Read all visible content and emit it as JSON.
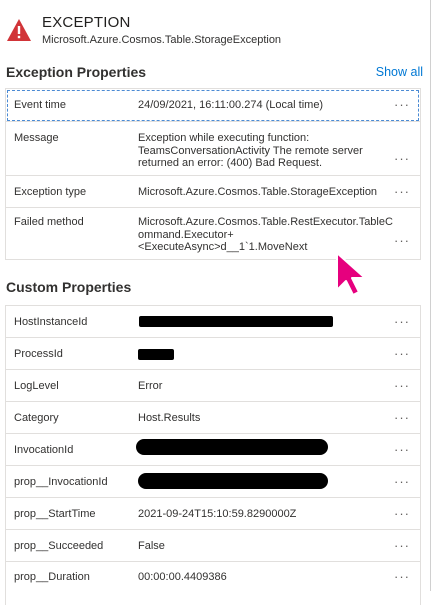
{
  "header": {
    "title": "EXCEPTION",
    "subtitle": "Microsoft.Azure.Cosmos.Table.StorageException",
    "icon": "warning-triangle-icon",
    "icon_color": "#d13438"
  },
  "exception_properties": {
    "title": "Exception Properties",
    "show_all": "Show all",
    "rows": [
      {
        "label": "Event time",
        "value_lines": [
          "24/09/2021, 16:11:00.274 (Local time)"
        ]
      },
      {
        "label": "Message",
        "value_lines": [
          "Exception while executing function:",
          "TeamsConversationActivity The remote server",
          "returned an error: (400) Bad Request."
        ]
      },
      {
        "label": "Exception type",
        "value_lines": [
          "Microsoft.Azure.Cosmos.Table.StorageException"
        ]
      },
      {
        "label": "Failed method",
        "value_lines": [
          "Microsoft.Azure.Cosmos.Table.RestExecutor.TableC",
          "ommand.Executor+",
          "<ExecuteAsync>d__1`1.MoveNext"
        ]
      }
    ]
  },
  "custom_properties": {
    "title": "Custom Properties",
    "rows": [
      {
        "label": "HostInstanceId",
        "value": ""
      },
      {
        "label": "ProcessId",
        "value": ""
      },
      {
        "label": "LogLevel",
        "value": "Error"
      },
      {
        "label": "Category",
        "value": "Host.Results"
      },
      {
        "label": "InvocationId",
        "value": ""
      },
      {
        "label": "prop__InvocationId",
        "value": ""
      },
      {
        "label": "prop__StartTime",
        "value": "2021-09-24T15:10:59.8290000Z"
      },
      {
        "label": "prop__Succeeded",
        "value": "False"
      },
      {
        "label": "prop__Duration",
        "value": "00:00:00.4409386"
      }
    ]
  },
  "more_glyph": "···",
  "colors": {
    "link": "#0078d4",
    "cursor": "#e6007e",
    "border": "#e1dfdd"
  }
}
